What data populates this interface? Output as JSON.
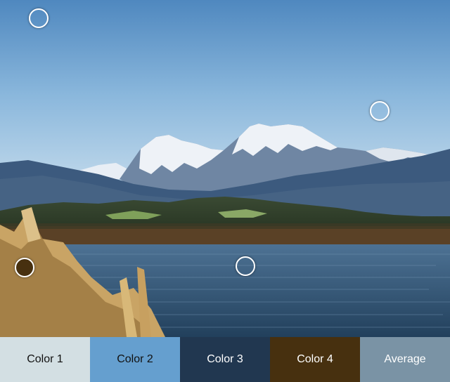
{
  "photo": {
    "colors": {
      "sky_top": "#4f88bf",
      "sky_mid": "#8ab7dc",
      "sky_bottom": "#cfe2ef",
      "far_mountains": "#3c5a7e",
      "snow": "#eef2f7",
      "rock": "#6f86a3",
      "forest": "#2c3a27",
      "meadow": "#7fa05a",
      "treeline": "#5a4126",
      "water": "#2b4d6b",
      "water_light": "#4d7294",
      "reeds": "#c9a465"
    }
  },
  "pickers": [
    {
      "name": "picker-1",
      "color": "transparent"
    },
    {
      "name": "picker-2",
      "color": "transparent"
    },
    {
      "name": "picker-3",
      "color": "transparent"
    },
    {
      "name": "picker-4",
      "color": "#47300f"
    }
  ],
  "swatches": [
    {
      "label": "Color 1",
      "bg": "#d3dfe3",
      "fg": "#111111"
    },
    {
      "label": "Color 2",
      "bg": "#659fcf",
      "fg": "#111111"
    },
    {
      "label": "Color 3",
      "bg": "#213750",
      "fg": "#ffffff"
    },
    {
      "label": "Color 4",
      "bg": "#47300f",
      "fg": "#ffffff"
    },
    {
      "label": "Average",
      "bg": "#7a93a5",
      "fg": "#ffffff"
    }
  ]
}
